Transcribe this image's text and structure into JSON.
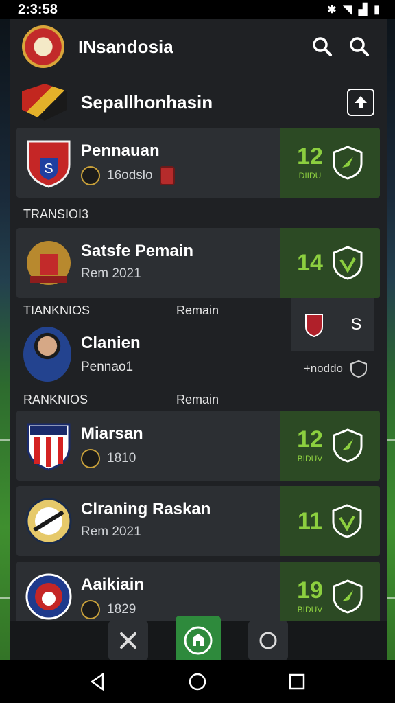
{
  "status_bar": {
    "time": "2:3:58"
  },
  "header": {
    "title": "INsandosia"
  },
  "subheader": {
    "title": "Sepallhonhasin"
  },
  "cards": [
    {
      "name": "Pennauan",
      "meta": "16odslo",
      "score": "12",
      "score_sub": "DIIDU"
    },
    {
      "name": "Satsfe Pemain",
      "meta": "Rem 2021",
      "score": "14",
      "score_sub": ""
    },
    {
      "name": "Miarsan",
      "meta": "1810",
      "score": "12",
      "score_sub": "BIDUV"
    },
    {
      "name": "Clraning Raskan",
      "meta": "Rem 2021",
      "score": "11",
      "score_sub": ""
    },
    {
      "name": "Aaikiain",
      "meta": "1829",
      "score": "19",
      "score_sub": "BIDUV"
    }
  ],
  "sections": {
    "transfers": "TRANSIOI3",
    "rankings_1": "TIANKNIOS",
    "rankings_1_right": "Remain",
    "rankings_2": "RANKNIOS",
    "rankings_2_right": "Remain"
  },
  "player_row": {
    "name": "Clanien",
    "meta": "Pennao1",
    "mini_label": "S",
    "link_text": "+noddo"
  },
  "bottom_bar": {
    "left_label": "",
    "right_label": ""
  },
  "colors": {
    "accent": "#8ccf3f",
    "panel": "#1f2124",
    "card": "#2c2f33",
    "score_bg": "#2c4a24"
  }
}
